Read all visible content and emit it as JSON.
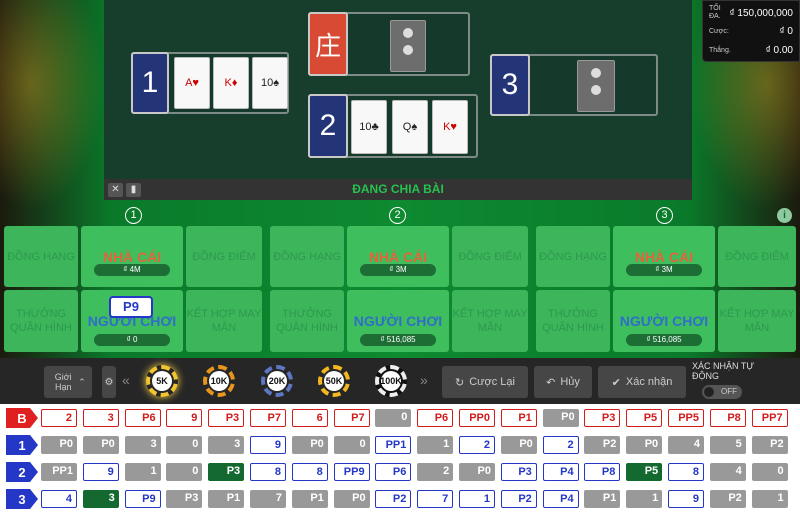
{
  "status": {
    "max_label": "TỐI ĐA.",
    "max_value": "₫ 150,000,000",
    "bet_label": "Cược:",
    "bet_value": "₫ 0",
    "win_label": "Thắng.",
    "win_value": "₫ 0.00"
  },
  "video": {
    "status": "ĐANG CHIA BÀI",
    "dealer_symbol": "庄",
    "box1": "1",
    "box2": "2",
    "box3": "3",
    "cards_1": [
      "A♥",
      "K♦",
      "10♠"
    ],
    "cards_2": [
      "10♣",
      "Q♠",
      "K♥"
    ]
  },
  "panels": [
    {
      "num": "1",
      "top": [
        "ĐỒNG HẠNG",
        "NHÀ CÁI",
        "ĐỒNG ĐIỂM"
      ],
      "banker_amt": "₫ 4M",
      "bottom": [
        "THƯỞNG QUÂN HÌNH",
        "NGƯỜI CHƠI",
        "KẾT HỢP MAY MẮN"
      ],
      "player_amt": "₫ 0",
      "badge": "P9"
    },
    {
      "num": "2",
      "top": [
        "ĐỒNG HẠNG",
        "NHÀ CÁI",
        "ĐỒNG ĐIỂM"
      ],
      "banker_amt": "₫ 3M",
      "bottom": [
        "THƯỞNG QUÂN HÌNH",
        "NGƯỜI CHƠI",
        "KẾT HỢP MAY MẮN"
      ],
      "player_amt": "₫ 516,085"
    },
    {
      "num": "3",
      "top": [
        "ĐỒNG HẠNG",
        "NHÀ CÁI",
        "ĐỒNG ĐIỂM"
      ],
      "banker_amt": "₫ 3M",
      "bottom": [
        "THƯỞNG QUÂN HÌNH",
        "NGƯỜI CHƠI",
        "KẾT HỢP MAY MẮN"
      ],
      "player_amt": "₫ 516,085"
    }
  ],
  "toolbar": {
    "limit": "Giới Hạn",
    "chips": [
      "5K",
      "10K",
      "20K",
      "50K",
      "100K"
    ],
    "rebet": "Cược Lại",
    "cancel": "Hủy",
    "confirm": "Xác nhận",
    "auto_confirm": "XÁC NHẬN TỰ ĐỘNG",
    "toggle": "OFF"
  },
  "colors": {
    "chip": [
      "#f3c52f",
      "#e8951b",
      "#5d76c4",
      "#f5b71f",
      "#eeeeee"
    ]
  },
  "road": [
    {
      "label": "B",
      "color": "#e02020",
      "cells": [
        [
          "2",
          "B"
        ],
        [
          "3",
          "B"
        ],
        [
          "P6",
          "B"
        ],
        [
          "9",
          "B"
        ],
        [
          "P3",
          "B"
        ],
        [
          "P7",
          "B"
        ],
        [
          "6",
          "B"
        ],
        [
          "P7",
          "B"
        ],
        [
          "0",
          "N"
        ],
        [
          "P6",
          "B"
        ],
        [
          "PP0",
          "B"
        ],
        [
          "P1",
          "B"
        ],
        [
          "P0",
          "N"
        ],
        [
          "P3",
          "B"
        ],
        [
          "P5",
          "B"
        ],
        [
          "PP5",
          "B"
        ],
        [
          "P8",
          "B"
        ],
        [
          "PP7",
          "B"
        ]
      ]
    },
    {
      "label": "1",
      "color": "#2437c7",
      "cells": [
        [
          "P0",
          "N"
        ],
        [
          "P0",
          "N"
        ],
        [
          "3",
          "N"
        ],
        [
          "0",
          "N"
        ],
        [
          "3",
          "N"
        ],
        [
          "9",
          "P"
        ],
        [
          "P0",
          "N"
        ],
        [
          "0",
          "N"
        ],
        [
          "PP1",
          "P"
        ],
        [
          "1",
          "N"
        ],
        [
          "2",
          "P"
        ],
        [
          "P0",
          "N"
        ],
        [
          "2",
          "P"
        ],
        [
          "P2",
          "N"
        ],
        [
          "P0",
          "N"
        ],
        [
          "4",
          "N"
        ],
        [
          "5",
          "N"
        ],
        [
          "P2",
          "N"
        ]
      ]
    },
    {
      "label": "2",
      "color": "#2437c7",
      "cells": [
        [
          "PP1",
          "N"
        ],
        [
          "9",
          "P"
        ],
        [
          "1",
          "N"
        ],
        [
          "0",
          "N"
        ],
        [
          "P3",
          "G"
        ],
        [
          "8",
          "P"
        ],
        [
          "8",
          "P"
        ],
        [
          "PP9",
          "P"
        ],
        [
          "P6",
          "P"
        ],
        [
          "2",
          "N"
        ],
        [
          "P0",
          "N"
        ],
        [
          "P3",
          "P"
        ],
        [
          "P4",
          "P"
        ],
        [
          "P8",
          "P"
        ],
        [
          "P5",
          "G"
        ],
        [
          "8",
          "P"
        ],
        [
          "4",
          "N"
        ],
        [
          "0",
          "N"
        ]
      ]
    },
    {
      "label": "3",
      "color": "#2437c7",
      "cells": [
        [
          "4",
          "P"
        ],
        [
          "3",
          "G"
        ],
        [
          "P9",
          "P"
        ],
        [
          "P3",
          "N"
        ],
        [
          "P1",
          "N"
        ],
        [
          "7",
          "N"
        ],
        [
          "P1",
          "N"
        ],
        [
          "P0",
          "N"
        ],
        [
          "P2",
          "P"
        ],
        [
          "7",
          "P"
        ],
        [
          "1",
          "P"
        ],
        [
          "P2",
          "P"
        ],
        [
          "P4",
          "P"
        ],
        [
          "P1",
          "N"
        ],
        [
          "1",
          "N"
        ],
        [
          "9",
          "P"
        ],
        [
          "P2",
          "N"
        ],
        [
          "1",
          "N"
        ]
      ]
    }
  ]
}
